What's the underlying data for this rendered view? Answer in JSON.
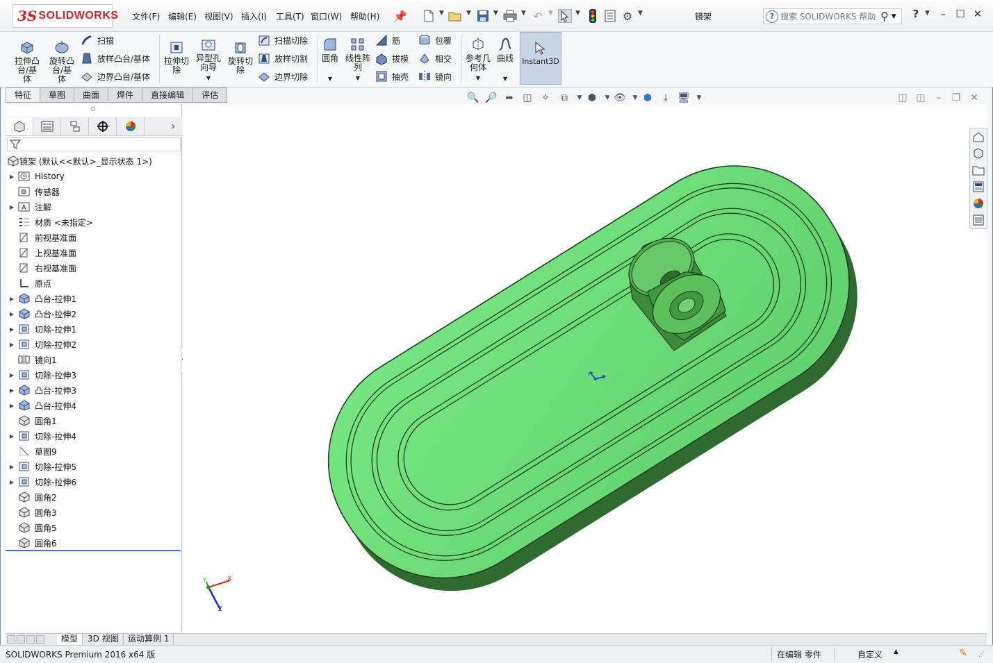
{
  "app": {
    "brand_ds": "3S",
    "brand_name": "SOLIDWORKS",
    "document_title": "镜架"
  },
  "menu": [
    "文件(F)",
    "编辑(E)",
    "视图(V)",
    "插入(I)",
    "工具(T)",
    "窗口(W)",
    "帮助(H)"
  ],
  "search": {
    "placeholder": "搜索 SOLIDWORKS 帮助"
  },
  "ribbon": {
    "extrude_boss": "拉伸凸台/基体",
    "revolve_boss": "旋转凸台/基体",
    "sweep": "扫描",
    "loft_boss": "放样凸台/基体",
    "boundary_boss": "边界凸台/基体",
    "extrude_cut": "拉伸切除",
    "hole_wizard": "异型孔向导",
    "revolve_cut": "旋转切除",
    "swept_cut": "扫描切除",
    "lofted_cut": "放样切割",
    "boundary_cut": "边界切除",
    "fillet": "圆角",
    "linear_pattern": "线性阵列",
    "rib": "筋",
    "draft": "拔模",
    "shell": "抽壳",
    "wrap": "包覆",
    "intersect": "相交",
    "mirror": "镜向",
    "ref_geometry": "参考几何体",
    "curves": "曲线",
    "instant3d": "Instant3D"
  },
  "cmd_tabs": [
    "特征",
    "草图",
    "曲面",
    "焊件",
    "直接编辑",
    "评估"
  ],
  "tree": {
    "root": "镜架 (默认<<默认>_显示状态 1>)",
    "items": [
      {
        "label": "History",
        "exp": true,
        "icon": "history-icon"
      },
      {
        "label": "传感器",
        "exp": false,
        "icon": "sensor-icon"
      },
      {
        "label": "注解",
        "exp": true,
        "icon": "annotation-icon"
      },
      {
        "label": "材质 <未指定>",
        "exp": false,
        "icon": "material-icon"
      },
      {
        "label": "前视基准面",
        "exp": false,
        "icon": "plane-icon"
      },
      {
        "label": "上视基准面",
        "exp": false,
        "icon": "plane-icon"
      },
      {
        "label": "右视基准面",
        "exp": false,
        "icon": "plane-icon"
      },
      {
        "label": "原点",
        "exp": false,
        "icon": "origin-icon"
      },
      {
        "label": "凸台-拉伸1",
        "exp": true,
        "icon": "boss-extrude-icon"
      },
      {
        "label": "凸台-拉伸2",
        "exp": true,
        "icon": "boss-extrude-icon"
      },
      {
        "label": "切除-拉伸1",
        "exp": true,
        "icon": "cut-extrude-icon"
      },
      {
        "label": "切除-拉伸2",
        "exp": true,
        "icon": "cut-extrude-icon"
      },
      {
        "label": "镜向1",
        "exp": false,
        "icon": "mirror-icon"
      },
      {
        "label": "切除-拉伸3",
        "exp": true,
        "icon": "cut-extrude-icon"
      },
      {
        "label": "凸台-拉伸3",
        "exp": true,
        "icon": "boss-extrude-icon"
      },
      {
        "label": "凸台-拉伸4",
        "exp": true,
        "icon": "boss-extrude-icon"
      },
      {
        "label": "圆角1",
        "exp": false,
        "icon": "fillet-icon"
      },
      {
        "label": "切除-拉伸4",
        "exp": true,
        "icon": "cut-extrude-icon"
      },
      {
        "label": "草图9",
        "exp": false,
        "icon": "sketch-icon"
      },
      {
        "label": "切除-拉伸5",
        "exp": true,
        "icon": "cut-extrude-icon"
      },
      {
        "label": "切除-拉伸6",
        "exp": true,
        "icon": "cut-extrude-icon"
      },
      {
        "label": "圆角2",
        "exp": false,
        "icon": "fillet-icon"
      },
      {
        "label": "圆角3",
        "exp": false,
        "icon": "fillet-icon"
      },
      {
        "label": "圆角5",
        "exp": false,
        "icon": "fillet-icon"
      },
      {
        "label": "圆角6",
        "exp": false,
        "icon": "fillet-icon"
      }
    ]
  },
  "triad": {
    "x": "X",
    "y": "Y",
    "z": "Z"
  },
  "model_tabs": [
    "模型",
    "3D 视图",
    "运动算例 1"
  ],
  "status": {
    "product": "SOLIDWORKS Premium 2016 x64 版",
    "editing": "在编辑 零件",
    "units": "自定义"
  },
  "colors": {
    "part_face": "#6fe07a",
    "part_side": "#2f6b2f",
    "accent": "#3d6ec0",
    "brand": "#d21f26"
  }
}
